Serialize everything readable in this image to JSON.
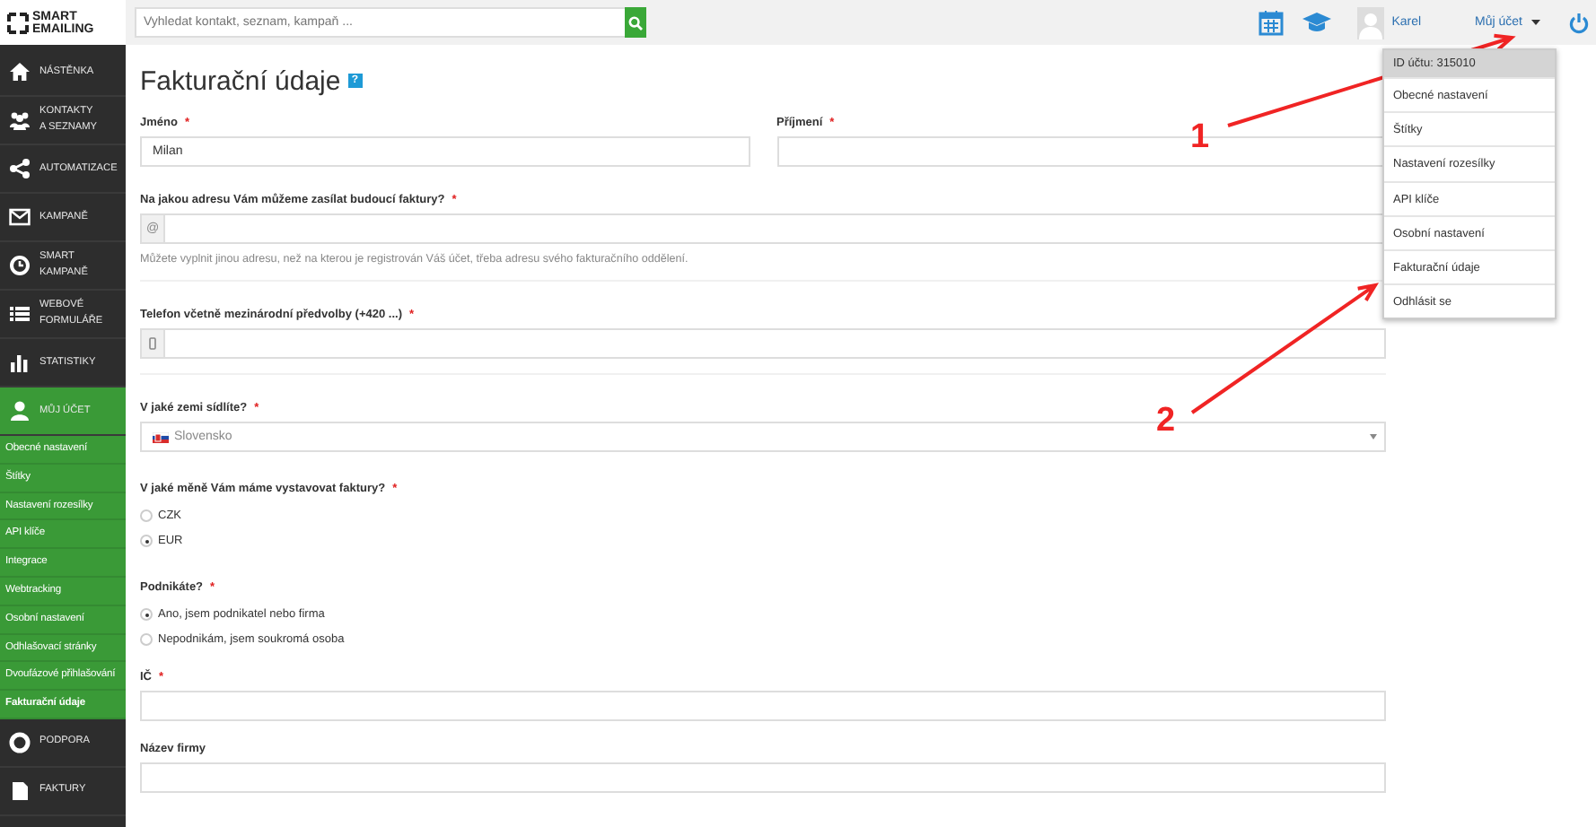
{
  "brand": {
    "line1": "SMART",
    "line2": "EMAILING"
  },
  "search": {
    "placeholder": "Vyhledat kontakt, seznam, kampaň ..."
  },
  "user": {
    "name": "Karel"
  },
  "account_menu": {
    "label": "Můj účet",
    "expanded": true,
    "header": "ID účtu: 315010",
    "items": [
      "Obecné nastavení",
      "Štítky",
      "Nastavení rozesílky",
      "API klíče",
      "Osobní nastavení",
      "Fakturační údaje",
      "Odhlásit se"
    ]
  },
  "sidebar": {
    "items": [
      {
        "label": "NÁSTĚNKA",
        "selected": false
      },
      {
        "label": "KONTAKTY\nA SEZNAMY",
        "selected": false
      },
      {
        "label": "AUTOMATIZACE",
        "selected": false
      },
      {
        "label": "KAMPANĚ",
        "selected": false
      },
      {
        "label": "SMART\nKAMPANĚ",
        "selected": false
      },
      {
        "label": "WEBOVÉ\nFORMULÁŘE",
        "selected": false
      },
      {
        "label": "STATISTIKY",
        "selected": false
      },
      {
        "label": "MŮJ ÚČET",
        "selected": true,
        "expanded": true,
        "children": [
          {
            "label": "Obecné nastavení",
            "selected": false
          },
          {
            "label": "Štítky",
            "selected": false
          },
          {
            "label": "Nastavení rozesílky",
            "selected": false
          },
          {
            "label": "API klíče",
            "selected": false
          },
          {
            "label": "Integrace",
            "selected": false
          },
          {
            "label": "Webtracking",
            "selected": false
          },
          {
            "label": "Osobní nastavení",
            "selected": false
          },
          {
            "label": "Odhlašovací stránky",
            "selected": false
          },
          {
            "label": "Dvoufázové přihlašování",
            "selected": false
          },
          {
            "label": "Fakturační údaje",
            "selected": true
          }
        ]
      },
      {
        "label": "PODPORA",
        "selected": false
      },
      {
        "label": "FAKTURY",
        "selected": false
      }
    ]
  },
  "form": {
    "title": "Fakturační údaje",
    "help": "?",
    "sections": [
      {
        "kind": "pair",
        "fields": [
          {
            "label": "Jméno",
            "mark": "*",
            "value": "Milan"
          },
          {
            "label": "Příjmení",
            "mark": "*"
          }
        ]
      },
      {
        "kind": "email",
        "label": "Na jakou adresu Vám můžeme zasílat budoucí faktury?",
        "mark": "*",
        "prefix": "@",
        "hint": "Můžete vyplnit jinou adresu, než na kterou je registrován Váš účet, třeba adresu svého fakturačního oddělení."
      },
      {
        "kind": "phone",
        "label": "Telefon včetně mezinárodní předvolby (+420 ...)",
        "mark": "*"
      },
      {
        "kind": "select",
        "label": "V jaké zemi sídlíte?",
        "mark": "*",
        "value": "Slovensko"
      },
      {
        "kind": "radio",
        "label": "V jaké měně Vám máme vystavovat faktury?",
        "mark": "*",
        "options": [
          {
            "label": "CZK",
            "selected": false
          },
          {
            "label": "EUR",
            "selected": true
          }
        ]
      },
      {
        "kind": "radio",
        "label": "Podnikáte?",
        "mark": "*",
        "options": [
          {
            "label": "Ano, jsem podnikatel nebo firma",
            "selected": true
          },
          {
            "label": "Nepodnikám, jsem soukromá osoba",
            "selected": false
          }
        ]
      },
      {
        "kind": "text",
        "label": "IČ",
        "mark": "*"
      },
      {
        "kind": "text",
        "label": "Název firmy"
      }
    ]
  },
  "annotations": [
    {
      "label": "1"
    },
    {
      "label": "2"
    }
  ]
}
